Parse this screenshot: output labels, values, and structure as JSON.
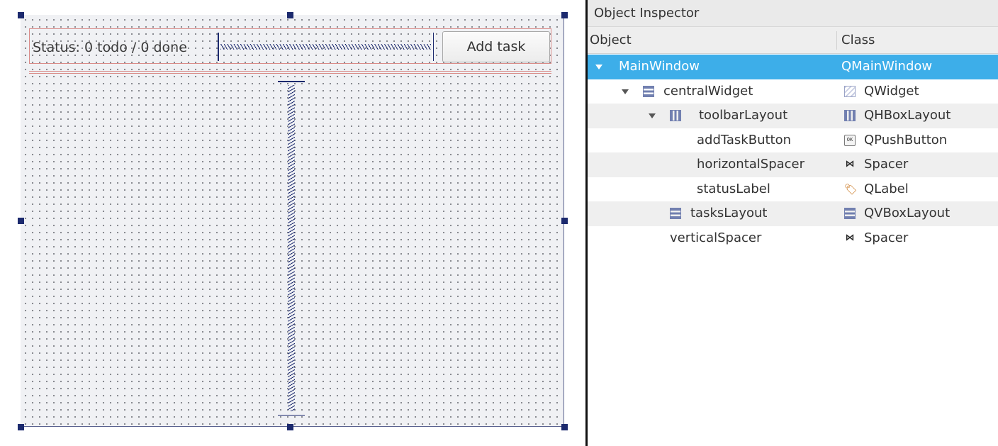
{
  "form": {
    "status_label": "Status: 0 todo / 0 done",
    "add_task_button": "Add task"
  },
  "inspector": {
    "title": "Object Inspector",
    "columns": {
      "object": "Object",
      "class": "Class"
    },
    "rows": [
      {
        "name": "MainWindow",
        "class": "QMainWindow",
        "icon": "none",
        "expanded": true,
        "selected": true
      },
      {
        "name": "centralWidget",
        "class": "QWidget",
        "icon": "vbox-layout-icon",
        "class_icon": "widget-icon",
        "expanded": true
      },
      {
        "name": "toolbarLayout",
        "class": "QHBoxLayout",
        "icon": "hbox-layout-icon",
        "class_icon": "hbox-layout-icon",
        "expanded": true
      },
      {
        "name": "addTaskButton",
        "class": "QPushButton",
        "class_icon": "push-button-icon"
      },
      {
        "name": "horizontalSpacer",
        "class": "Spacer",
        "class_icon": "spacer-icon"
      },
      {
        "name": "statusLabel",
        "class": "QLabel",
        "class_icon": "label-tag-icon"
      },
      {
        "name": "tasksLayout",
        "class": "QVBoxLayout",
        "icon": "vbox-layout-icon",
        "class_icon": "vbox-layout-icon"
      },
      {
        "name": "verticalSpacer",
        "class": "Spacer",
        "class_icon": "spacer-icon"
      }
    ],
    "push_button_icon_text": "OK",
    "spacer_icon_glyph": "⋈",
    "label_icon_glyph": "🏷",
    "selection_color": "#3daee9"
  },
  "colors": {
    "handle": "#1c2a6e",
    "layout_border": "#d98b88"
  }
}
